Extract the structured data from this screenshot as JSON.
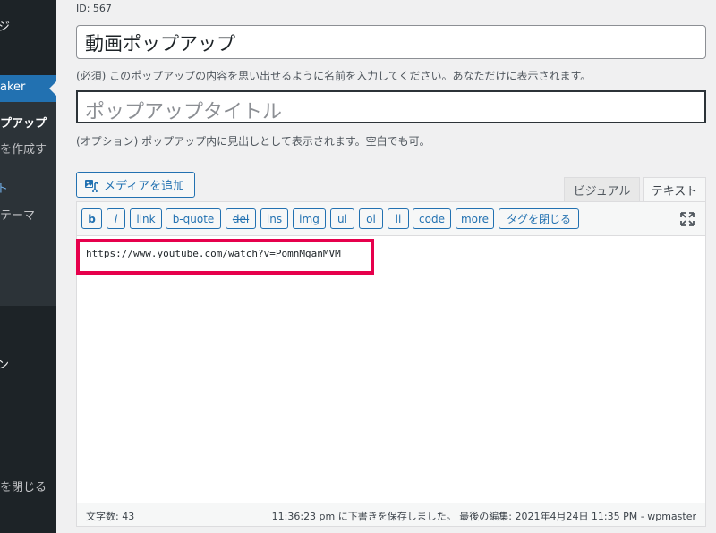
{
  "sidebar": {
    "frag1": "ジ",
    "active_item": "aker",
    "sub_current": "プアップ",
    "sub_add": "を作成す",
    "green_frag": "ト",
    "theme_frag": "テーマ",
    "frag_n": "ン",
    "collapse": "を閉じる",
    "colors": {
      "bg": "#1d2327",
      "active": "#2271b1",
      "green": "#72aee6"
    }
  },
  "post": {
    "id_label": "ID: 567",
    "title_value": "動画ポップアップ",
    "title_help": "(必須) このポップアップの内容を思い出せるように名前を入力してください。あなただけに表示されます。",
    "popup_title_placeholder": "ポップアップタイトル",
    "popup_title_help": "(オプション) ポップアップ内に見出しとして表示されます。空白でも可。"
  },
  "editor": {
    "media_button": "メディアを追加",
    "tabs": {
      "visual": "ビジュアル",
      "text": "テキスト"
    },
    "quicktags": [
      "b",
      "i",
      "link",
      "b-quote",
      "del",
      "ins",
      "img",
      "ul",
      "ol",
      "li",
      "code",
      "more",
      "タグを閉じる"
    ],
    "content": "https://www.youtube.com/watch?v=PomnMganMVM",
    "highlight_color": "#e6004c",
    "word_count": "文字数: 43",
    "autosave": "11:36:23 pm に下書きを保存しました。 最後の編集: 2021年4月24日 11:35 PM - wpmaster"
  },
  "icons": {
    "media": "media-icon",
    "fullscreen": "fullscreen-icon"
  }
}
